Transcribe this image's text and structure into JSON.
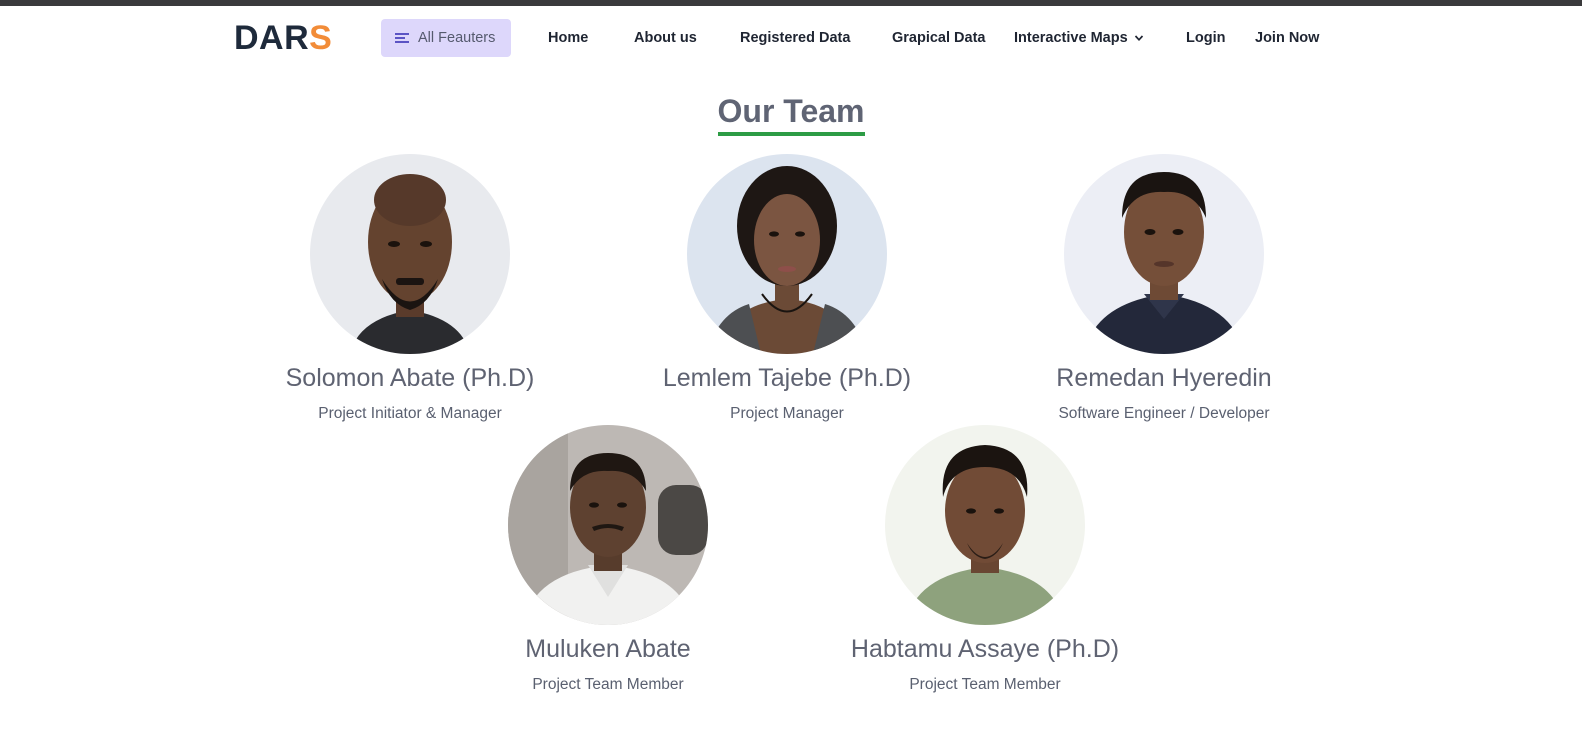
{
  "logo": {
    "main": "DAR",
    "accent": "S"
  },
  "nav": {
    "features_label": "All Feauters",
    "links": [
      "Home",
      "About us",
      "Registered Data",
      "Grapical Data",
      "Interactive Maps",
      "Login",
      "Join Now"
    ]
  },
  "heading": "Our Team",
  "members": [
    {
      "name": "Solomon Abate (Ph.D)",
      "role": "Project Initiator & Manager"
    },
    {
      "name": "Lemlem Tajebe (Ph.D)",
      "role": "Project Manager"
    },
    {
      "name": "Remedan Hyeredin",
      "role": "Software Engineer / Developer"
    },
    {
      "name": "Muluken Abate",
      "role": "Project Team Member"
    },
    {
      "name": "Habtamu Assaye (Ph.D)",
      "role": "Project Team Member"
    }
  ],
  "colors": {
    "logo_dark": "#1e2a3b",
    "logo_accent": "#f28c38",
    "features_bg": "#ddd7fb",
    "heading_underline": "#2d9c45"
  }
}
